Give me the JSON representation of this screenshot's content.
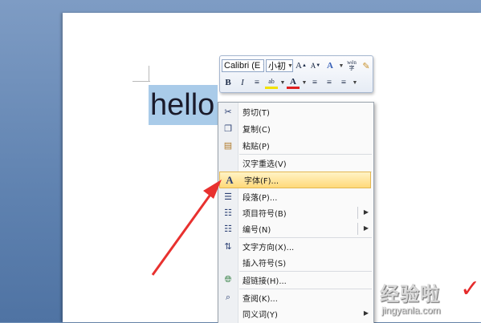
{
  "document": {
    "text": "hello"
  },
  "mini_toolbar": {
    "font_name": "Calibri (E",
    "font_size": "小初",
    "row1_buttons": [
      "A",
      "A",
      "A",
      "wén",
      "✎"
    ],
    "row2_buttons": [
      "B",
      "I",
      "≡",
      "ab",
      "A",
      "≡",
      "≡",
      "≡"
    ]
  },
  "context_menu": {
    "items": [
      {
        "icon": "cut-icon",
        "label": "剪切(T)"
      },
      {
        "icon": "copy-icon",
        "label": "复制(C)"
      },
      {
        "icon": "paste-icon",
        "label": "粘贴(P)"
      },
      {
        "icon": "",
        "label": "汉字重选(V)"
      },
      {
        "icon": "font-icon",
        "label": "字体(F)..."
      },
      {
        "icon": "paragraph-icon",
        "label": "段落(P)..."
      },
      {
        "icon": "bullets-icon",
        "label": "项目符号(B)"
      },
      {
        "icon": "numbering-icon",
        "label": "编号(N)"
      },
      {
        "icon": "text-direction-icon",
        "label": "文字方向(X)..."
      },
      {
        "icon": "",
        "label": "插入符号(S)"
      },
      {
        "icon": "hyperlink-icon",
        "label": "超链接(H)..."
      },
      {
        "icon": "lookup-icon",
        "label": "查阅(K)..."
      },
      {
        "icon": "",
        "label": "同义词(Y)"
      }
    ]
  },
  "watermark": {
    "title": "经验啦",
    "url": "jingyanla.com"
  },
  "colors": {
    "highlight": "#ffd97a",
    "selection": "#a9cbe9",
    "arrow": "#e8312f"
  }
}
